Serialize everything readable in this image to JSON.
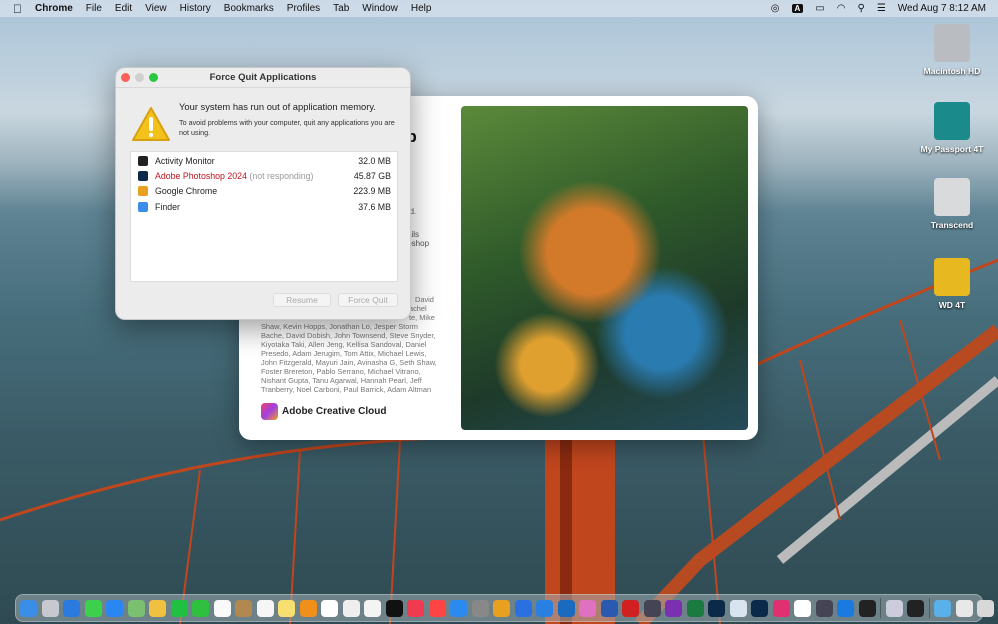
{
  "menubar": {
    "app": "Chrome",
    "items": [
      "File",
      "Edit",
      "View",
      "History",
      "Bookmarks",
      "Profiles",
      "Tab",
      "Window",
      "Help"
    ],
    "input_source": "A",
    "datetime": "Wed Aug 7  8:12 AM"
  },
  "desktop": {
    "icons": [
      {
        "label": "Macintosh HD",
        "color": "#b9bcc0"
      },
      {
        "label": "My Passport 4T",
        "color": "#1a8a8a"
      },
      {
        "label": "Transcend",
        "color": "#d8dadc"
      },
      {
        "label": "WD 4T",
        "color": "#e8b820"
      }
    ]
  },
  "splash": {
    "title_fragment": "op",
    "fragments": [
      "ed.",
      "ails",
      "toshop",
      "David",
      "achel",
      "te, Mike"
    ],
    "credits": "Shaw, Kevin Hopps, Jonathan Lo, Jesper Storm Bache, David Dobish, John Townsend, Steve Snyder, Kiyotaka Taki, Allen Jeng, Kellisa Sandoval, Daniel Presedo, Adam Jerugim, Tom Attix, Michael Lewis, John Fitzgerald, Mayuri Jain, Avinasha G, Seth Shaw, Foster Brereton, Pablo Serrano, Michael Vitrano, Nishant Gupta, Tanu Agarwal, Hannah Pearl, Jeff Tranberry, Noel Carboni, Paul Barrick, Adam Altman",
    "brand": "Adobe Creative Cloud"
  },
  "dialog": {
    "title": "Force Quit Applications",
    "message": "Your system has run out of application memory.",
    "detail": "To avoid problems with your computer, quit any applications you are not using.",
    "apps": [
      {
        "name": "Activity Monitor",
        "status": "",
        "memory": "32.0 MB",
        "icon": "activity-monitor-icon",
        "color": "#222",
        "name_color": "#222"
      },
      {
        "name": "Adobe Photoshop 2024",
        "status": "(not responding)",
        "memory": "45.87 GB",
        "icon": "photoshop-icon",
        "color": "#0b2a4a",
        "name_color": "#c0141c"
      },
      {
        "name": "Google Chrome",
        "status": "",
        "memory": "223.9 MB",
        "icon": "chrome-icon",
        "color": "#e8a020",
        "name_color": "#222"
      },
      {
        "name": "Finder",
        "status": "",
        "memory": "37.6 MB",
        "icon": "finder-icon",
        "color": "#3a8ee8",
        "name_color": "#222"
      }
    ],
    "resume": "Resume",
    "force_quit": "Force Quit"
  },
  "dock": {
    "apps": [
      [
        "finder",
        "#3a8ee8"
      ],
      [
        "launchpad",
        "#c8c8d0"
      ],
      [
        "safari",
        "#2a7ae0"
      ],
      [
        "messages",
        "#3cd04c"
      ],
      [
        "mail",
        "#2a86f0"
      ],
      [
        "maps",
        "#7ac070"
      ],
      [
        "photos",
        "#f0c040"
      ],
      [
        "wechat",
        "#20c040"
      ],
      [
        "facetime",
        "#30c040"
      ],
      [
        "calendar",
        "#fafafa"
      ],
      [
        "contacts",
        "#b08850"
      ],
      [
        "reminders",
        "#f6f6f6"
      ],
      [
        "notes",
        "#f8e070"
      ],
      [
        "pages",
        "#f0901a"
      ],
      [
        "notion",
        "#fff"
      ],
      [
        "textedit",
        "#eee"
      ],
      [
        "freeform",
        "#f4f4f4"
      ],
      [
        "apple-tv",
        "#111"
      ],
      [
        "music",
        "#f03a50"
      ],
      [
        "news",
        "#f44"
      ],
      [
        "app-store",
        "#2a8af0"
      ],
      [
        "system-settings",
        "#888"
      ],
      [
        "chrome",
        "#e8a020"
      ],
      [
        "todo",
        "#2a70e0"
      ],
      [
        "onedrive",
        "#2a80e0"
      ],
      [
        "outlook",
        "#1a6ac0"
      ],
      [
        "copilot",
        "#e070c0"
      ],
      [
        "word",
        "#2a5ab0"
      ],
      [
        "pdf-expert",
        "#d02020"
      ],
      [
        "davinci",
        "#445"
      ],
      [
        "onenote",
        "#7a30b0"
      ],
      [
        "excel",
        "#1a7a40"
      ],
      [
        "photoshop",
        "#0b2a4a"
      ],
      [
        "photoshop-beta",
        "#d8e4f0"
      ],
      [
        "lightroom-classic",
        "#0b2a4a"
      ],
      [
        "creative-cloud",
        "#e03070"
      ],
      [
        "capcut",
        "#fff"
      ],
      [
        "quicktime",
        "#445"
      ],
      [
        "edge",
        "#1a7ae0"
      ],
      [
        "terminal",
        "#222"
      ],
      [
        "sep",
        ""
      ],
      [
        "preview",
        "#ccd"
      ],
      [
        "activity-monitor",
        "#222"
      ],
      [
        "sep",
        ""
      ],
      [
        "downloads",
        "#5ab0e8"
      ],
      [
        "screenshots",
        "#e8e8e8"
      ],
      [
        "trash",
        "#d8d8d8"
      ]
    ]
  }
}
